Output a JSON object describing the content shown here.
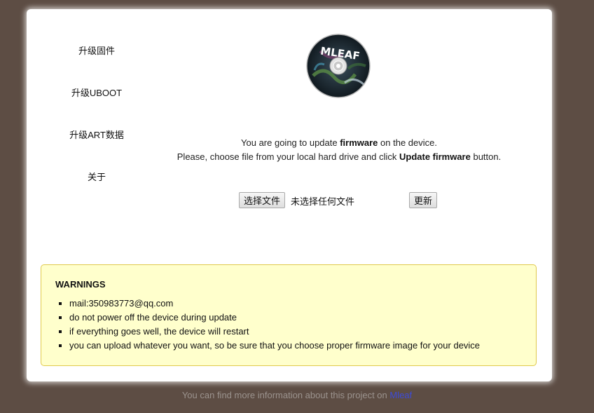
{
  "nav": {
    "items": [
      {
        "label": "升级固件"
      },
      {
        "label": "升级UBOOT"
      },
      {
        "label": "升级ART数据"
      },
      {
        "label": "关于"
      }
    ]
  },
  "logo": {
    "text": "MLEAF",
    "colors": {
      "disc": "#1c2a33",
      "hub": "#d9d9d9"
    }
  },
  "info": {
    "line1_pre": "You are going to update ",
    "line1_bold": "firmware",
    "line1_post": " on the device.",
    "line2_pre": "Please, choose file from your local hard drive and click ",
    "line2_bold": "Update firmware",
    "line2_post": " button."
  },
  "upload": {
    "choose_button": "选择文件",
    "file_status": "未选择任何文件",
    "update_button": "更新"
  },
  "warnings": {
    "title": "WARNINGS",
    "items": [
      "mail:350983773@qq.com",
      "do not power off the device during update",
      "if everything goes well, the device will restart",
      "you can upload whatever you want, so be sure that you choose proper firmware image for your device"
    ]
  },
  "footer": {
    "text": "You can find more information about this project on ",
    "link": "Mleaf"
  },
  "colors": {
    "background": "#5d4d44",
    "warning_bg": "#ffffcc",
    "warning_border": "#e0c94c",
    "link": "#3d4bd8"
  }
}
